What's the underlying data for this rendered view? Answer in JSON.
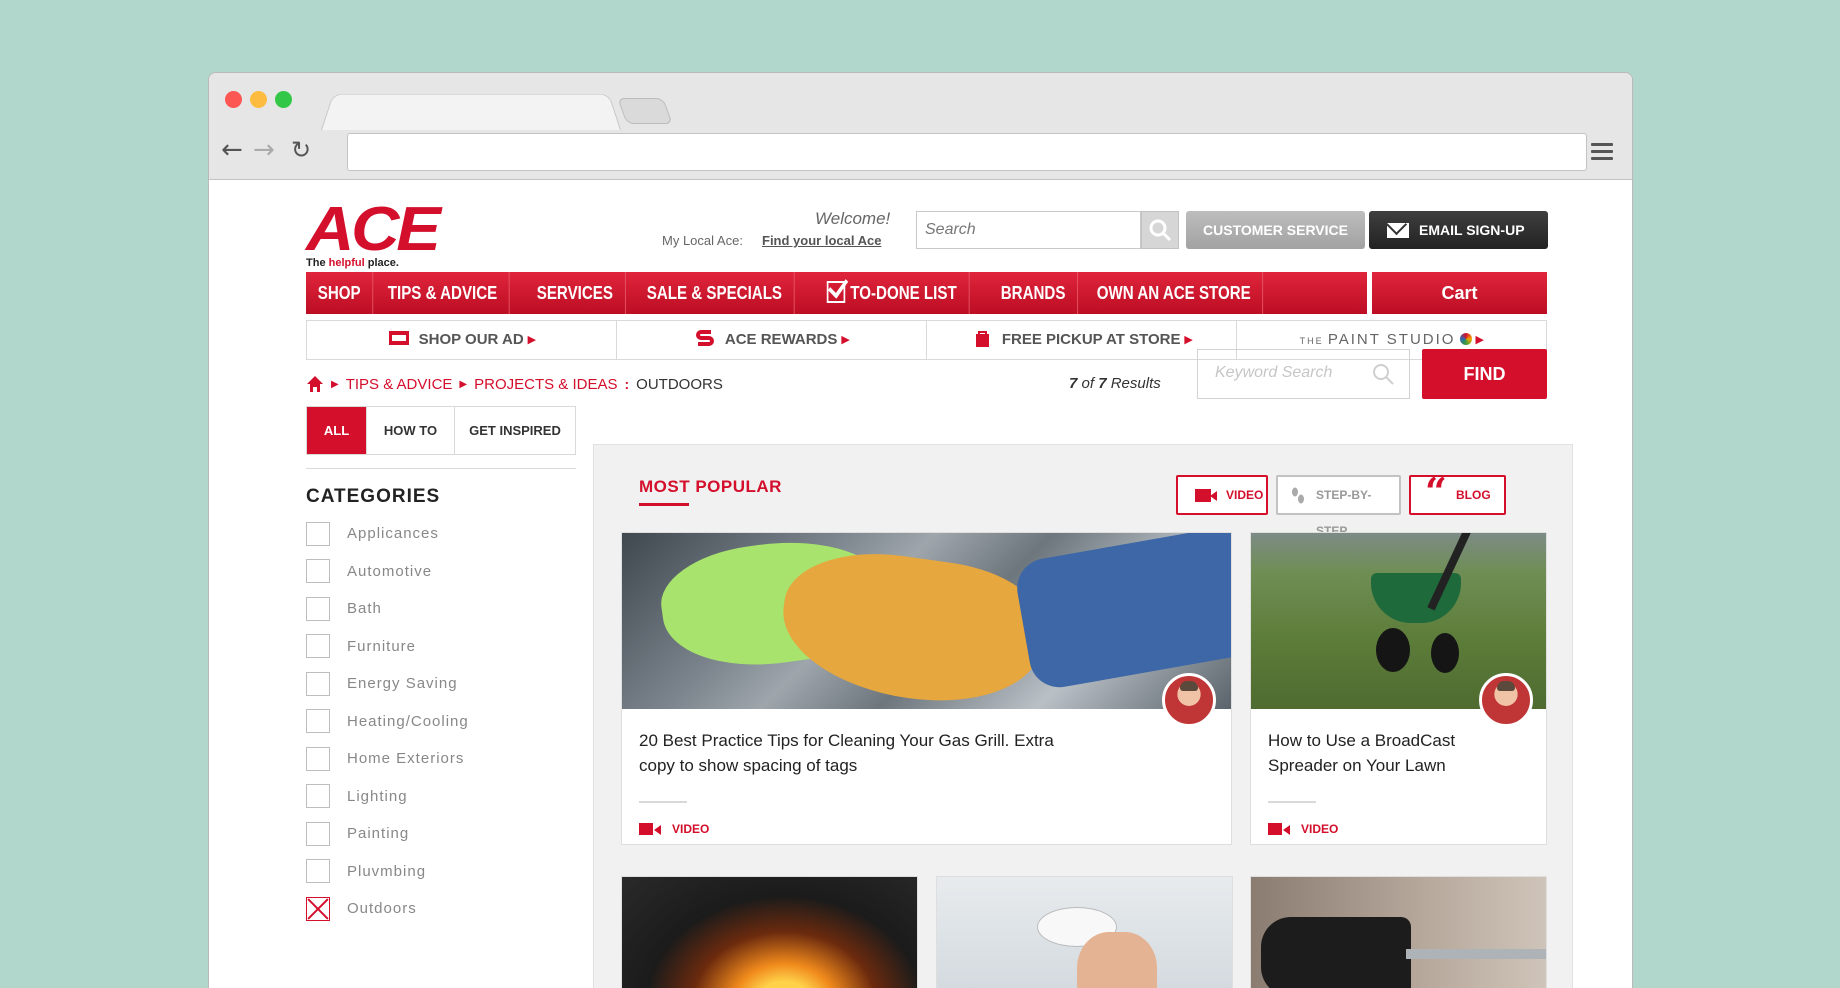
{
  "header": {
    "logo_text": "ACE",
    "tagline_pre": "The ",
    "tagline_hl": "helpful",
    "tagline_post": " place.",
    "welcome": "Welcome!",
    "local_label": "My Local Ace:",
    "local_link": "Find your local Ace",
    "search_placeholder": "Search",
    "customer_service": "CUSTOMER SERVICE",
    "email_signup": "EMAIL SIGN-UP"
  },
  "nav": {
    "items": [
      "SHOP",
      "TIPS & ADVICE",
      "SERVICES",
      "SALE & SPECIALS",
      "TO-DONE LIST",
      "BRANDS",
      "OWN AN ACE STORE"
    ],
    "cart": "Cart"
  },
  "subnav": {
    "items": [
      "SHOP OUR AD",
      "ACE REWARDS",
      "FREE PICKUP AT STORE"
    ],
    "paint_prefix": "THE",
    "paint_name": "PAINT STUDIO"
  },
  "breadcrumb": {
    "items": [
      "TIPS & ADVICE",
      "PROJECTS & IDEAS"
    ],
    "current": "OUTDOORS"
  },
  "results": {
    "count": "7",
    "of": "of",
    "total": "7",
    "label": "Results"
  },
  "keyword_search": {
    "placeholder": "Keyword Search",
    "button": "FIND"
  },
  "filters": {
    "tabs": [
      "ALL",
      "HOW TO",
      "GET INSPIRED"
    ],
    "active": "ALL"
  },
  "categories": {
    "title": "CATEGORIES",
    "items": [
      {
        "label": "Applicances",
        "checked": false
      },
      {
        "label": "Automotive",
        "checked": false
      },
      {
        "label": "Bath",
        "checked": false
      },
      {
        "label": "Furniture",
        "checked": false
      },
      {
        "label": "Energy Saving",
        "checked": false
      },
      {
        "label": "Heating/Cooling",
        "checked": false
      },
      {
        "label": "Home Exteriors",
        "checked": false
      },
      {
        "label": "Lighting",
        "checked": false
      },
      {
        "label": "Painting",
        "checked": false
      },
      {
        "label": "Pluvmbing",
        "checked": false
      },
      {
        "label": "Outdoors",
        "checked": true
      }
    ]
  },
  "content": {
    "section_title": "MOST POPULAR",
    "type_filters": [
      "VIDEO",
      "STEP-BY-STEP",
      "BLOG"
    ],
    "cards": [
      {
        "title": "20 Best Practice Tips for Cleaning Your Gas Grill. Extra copy to show spacing of tags",
        "tag": "VIDEO"
      },
      {
        "title": "How to Use a BroadCast Spreader on Your Lawn",
        "tag": "VIDEO"
      }
    ]
  },
  "colors": {
    "brand_red": "#d40f2c",
    "background": "#b1d6cb"
  }
}
